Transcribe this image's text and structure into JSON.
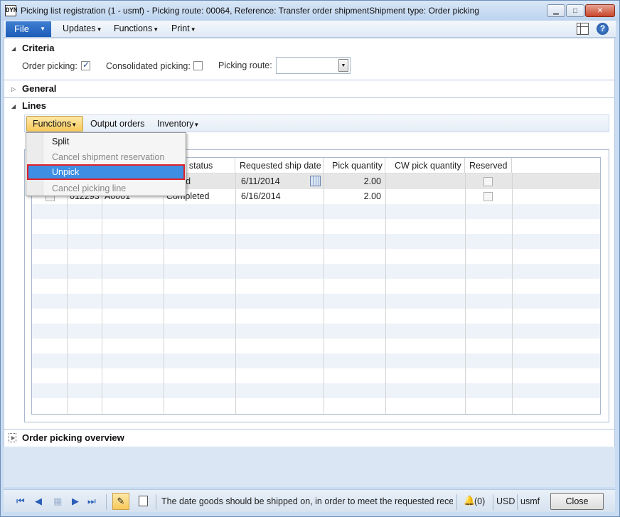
{
  "window": {
    "title": "Picking list registration (1 - usmf) - Picking route: 00064, Reference: Transfer order shipmentShipment type: Order picking",
    "app_icon": "DYN"
  },
  "menubar": {
    "file": "File",
    "items": [
      "Updates",
      "Functions",
      "Print"
    ]
  },
  "criteria": {
    "title": "Criteria",
    "order_picking_label": "Order picking:",
    "order_picking_checked": true,
    "consolidated_picking_label": "Consolidated picking:",
    "consolidated_picking_checked": false,
    "picking_route_label": "Picking route:",
    "picking_route_value": ""
  },
  "general": {
    "title": "General"
  },
  "lines": {
    "title": "Lines",
    "toolbar": {
      "functions": "Functions",
      "output_orders": "Output orders",
      "inventory": "Inventory"
    },
    "functions_menu": {
      "items": [
        {
          "label": "Split",
          "enabled": true
        },
        {
          "label": "Cancel shipment reservation",
          "enabled": false
        },
        {
          "label": "Unpick",
          "enabled": true,
          "highlighted": true
        },
        {
          "label": "Cancel picking line",
          "enabled": false
        }
      ]
    },
    "grid": {
      "columns": [
        "",
        "",
        "",
        "dling status",
        "Requested ship date",
        "Pick quantity",
        "CW  pick quantity",
        "Reserved"
      ],
      "rows": [
        {
          "id": "",
          "item": "",
          "status": "pleted",
          "ship_date": "6/11/2014",
          "pick_qty": "2.00",
          "cw_qty": "",
          "reserved": false,
          "selected": true
        },
        {
          "id": "012293",
          "item": "A0001",
          "status": "Completed",
          "ship_date": "6/16/2014",
          "pick_qty": "2.00",
          "cw_qty": "",
          "reserved": false,
          "selected": false
        }
      ]
    }
  },
  "overview": {
    "title": "Order picking overview"
  },
  "statusbar": {
    "message": "The date goods should be shipped on, in order to meet the requested recei...",
    "notifications": "(0)",
    "currency": "USD",
    "company": "usmf",
    "close": "Close"
  },
  "colors": {
    "accent": "#1d5cb8",
    "highlight": "#3e8fe4",
    "highlight_border": "#e0202a",
    "functions_button": "#f7c95a"
  }
}
